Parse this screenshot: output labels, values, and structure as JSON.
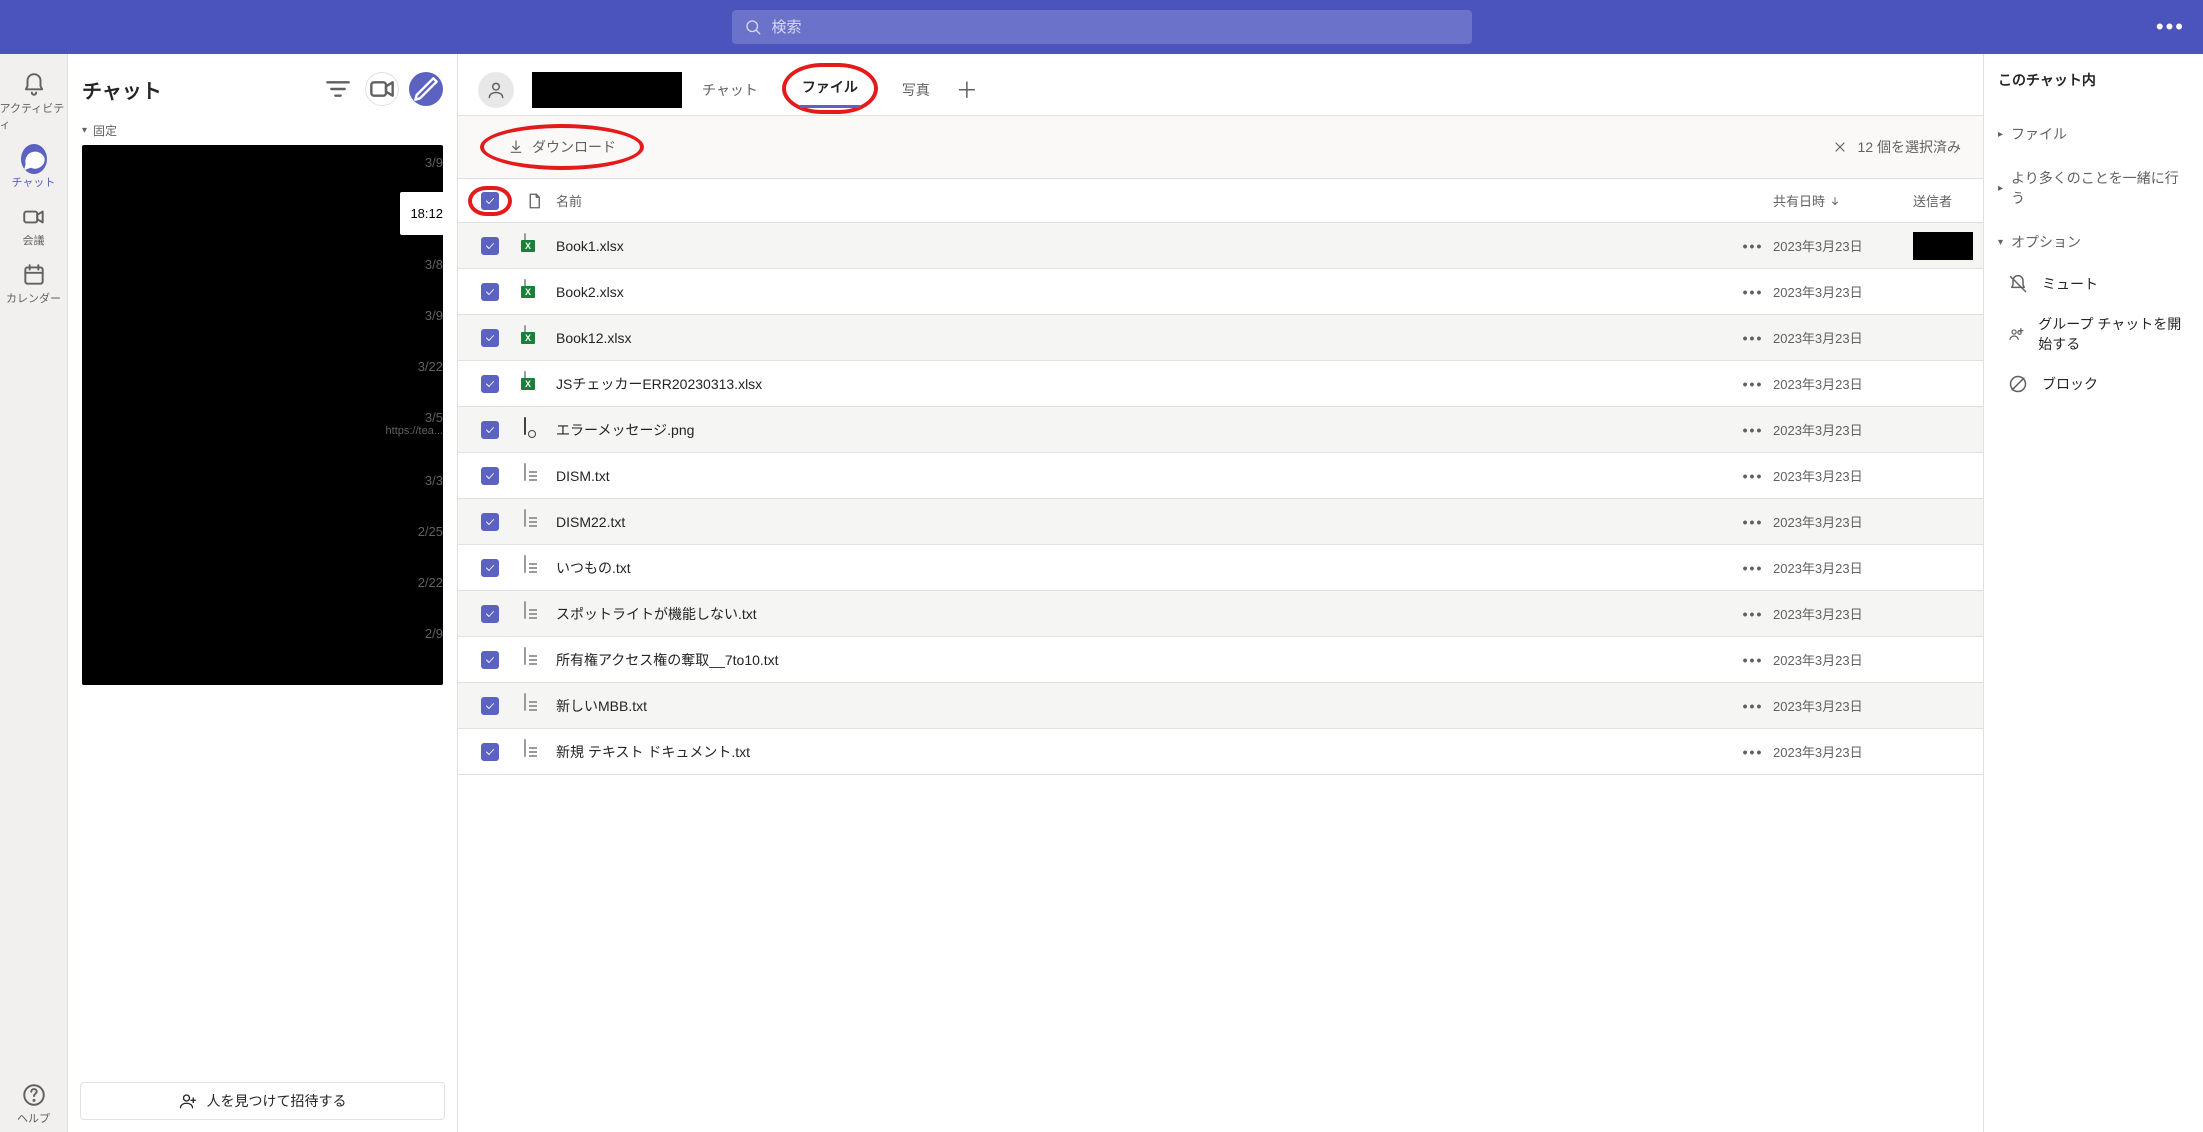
{
  "search": {
    "placeholder": "検索"
  },
  "rail": {
    "activity": "アクティビティ",
    "chat": "チャット",
    "meeting": "会議",
    "calendar": "カレンダー",
    "help": "ヘルプ"
  },
  "chatlist": {
    "title": "チャット",
    "pinned_label": "固定",
    "invite_label": "人を見つけて招待する",
    "dates": [
      "3/9",
      "18:12",
      "3/8",
      "3/9",
      "3/22",
      "3/5",
      "3/3",
      "2/25",
      "2/22",
      "2/9"
    ],
    "preview_url": "https://tea..."
  },
  "convo": {
    "tabs": {
      "chat": "チャット",
      "files": "ファイル",
      "photos": "写真"
    }
  },
  "toolbar": {
    "download": "ダウンロード",
    "selection": "12 個を選択済み"
  },
  "columns": {
    "name": "名前",
    "shared": "共有日時",
    "sender": "送信者"
  },
  "files": [
    {
      "name": "Book1.xlsx",
      "type": "excel",
      "date": "2023年3月23日"
    },
    {
      "name": "Book2.xlsx",
      "type": "excel",
      "date": "2023年3月23日"
    },
    {
      "name": "Book12.xlsx",
      "type": "excel",
      "date": "2023年3月23日"
    },
    {
      "name": "JSチェッカーERR20230313.xlsx",
      "type": "excel",
      "date": "2023年3月23日"
    },
    {
      "name": "エラーメッセージ.png",
      "type": "image",
      "date": "2023年3月23日"
    },
    {
      "name": "DISM.txt",
      "type": "text",
      "date": "2023年3月23日"
    },
    {
      "name": "DISM22.txt",
      "type": "text",
      "date": "2023年3月23日"
    },
    {
      "name": "いつもの.txt",
      "type": "text",
      "date": "2023年3月23日"
    },
    {
      "name": "スポットライトが機能しない.txt",
      "type": "text",
      "date": "2023年3月23日"
    },
    {
      "name": "所有権アクセス権の奪取__7to10.txt",
      "type": "text",
      "date": "2023年3月23日"
    },
    {
      "name": "新しいMBB.txt",
      "type": "text",
      "date": "2023年3月23日"
    },
    {
      "name": "新規 テキスト ドキュメント.txt",
      "type": "text",
      "date": "2023年3月23日"
    }
  ],
  "rpanel": {
    "title": "このチャット内",
    "files": "ファイル",
    "more": "より多くのことを一緒に行う",
    "options": "オプション",
    "mute": "ミュート",
    "group": "グループ チャットを開始する",
    "block": "ブロック"
  },
  "icons": {
    "more": "•••"
  }
}
